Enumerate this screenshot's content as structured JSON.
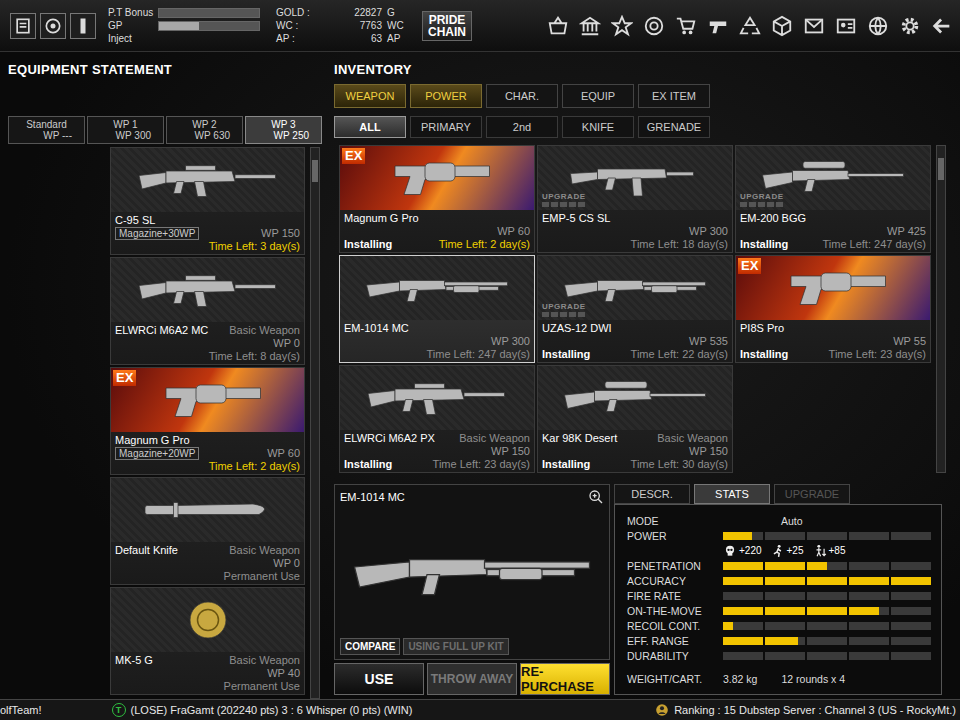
{
  "top_bar": {
    "pt_bonus": {
      "label": "P.T Bonus",
      "level": 0
    },
    "gp": {
      "label": "GP",
      "level": 0.4
    },
    "inject": "Inject",
    "currency": [
      {
        "label": "GOLD :",
        "value": "22827",
        "unit": "G"
      },
      {
        "label": "WC :",
        "value": "7763",
        "unit": "WC"
      },
      {
        "label": "AP :",
        "value": "63",
        "unit": "AP"
      }
    ],
    "logo": [
      "PRIDE",
      "CHAIN"
    ]
  },
  "equipment": {
    "title": "EQUIPMENT STATEMENT",
    "sets": [
      {
        "label": "Standard",
        "wp": "WP ---",
        "selected": false
      },
      {
        "label": "WP 1",
        "wp": "WP 300",
        "selected": false
      },
      {
        "label": "WP 2",
        "wp": "WP 630",
        "selected": false
      },
      {
        "label": "WP 3",
        "wp": "WP 250",
        "selected": true
      }
    ],
    "items": [
      {
        "name": "C-95 SL",
        "kind": "rifle",
        "tag": "Magazine+30WP",
        "wp": "WP 150",
        "time": "Time Left: 3 day(s)",
        "warn": true
      },
      {
        "name": "ELWRCi M6A2 MC",
        "kind": "rifle",
        "type": "Basic Weapon",
        "wp": "WP 0",
        "time": "Time Left: 8 day(s)",
        "warn": false
      },
      {
        "name": "Magnum G Pro",
        "kind": "pistol",
        "badge": {
          "text": "EX",
          "kind": "ex"
        },
        "tag": "Magazine+20WP",
        "wp": "WP 60",
        "time": "Time Left: 2 day(s)",
        "warn": true
      },
      {
        "name": "Default Knife",
        "kind": "knife",
        "type": "Basic Weapon",
        "wp": "WP 0",
        "time": "Permanent Use",
        "warn": false
      },
      {
        "name": "MK-5 G",
        "kind": "grenade",
        "type": "Basic Weapon",
        "wp": "WP 40",
        "time": "Permanent Use",
        "warn": false
      }
    ]
  },
  "inventory": {
    "title": "INVENTORY",
    "tabs": [
      {
        "label": "WEAPON",
        "selected": true,
        "hovered": false
      },
      {
        "label": "POWER",
        "selected": false,
        "hovered": true
      },
      {
        "label": "CHAR.",
        "selected": false,
        "hovered": false
      },
      {
        "label": "EQUIP",
        "selected": false,
        "hovered": false
      },
      {
        "label": "EX ITEM",
        "selected": false,
        "hovered": false
      }
    ],
    "subtabs": [
      {
        "label": "ALL",
        "selected": true
      },
      {
        "label": "PRIMARY",
        "selected": false
      },
      {
        "label": "2nd",
        "selected": false
      },
      {
        "label": "KNIFE",
        "selected": false
      },
      {
        "label": "GRENADE",
        "selected": false
      }
    ],
    "items": [
      {
        "name": "Magnum G Pro",
        "kind": "pistol",
        "badge": {
          "text": "EX",
          "kind": "ex"
        },
        "wp": "WP 60",
        "status": "Installing",
        "time": "Time Left: 2 day(s)",
        "warn": true,
        "selected": false
      },
      {
        "name": "EMP-5 CS SL",
        "kind": "smg",
        "badge": {
          "text": "UPGRADE",
          "kind": "upgrade"
        },
        "wp": "WP 300",
        "time": "Time Left: 18 day(s)",
        "warn": false,
        "selected": false
      },
      {
        "name": "EM-200 BGG",
        "kind": "sniper",
        "badge": {
          "text": "UPGRADE",
          "kind": "upgrade"
        },
        "wp": "WP 425",
        "status": "Installing",
        "time": "Time Left: 247 day(s)",
        "warn": false,
        "selected": false
      },
      {
        "name": "EM-1014 MC",
        "kind": "shotgun",
        "wp": "WP 300",
        "time": "Time Left: 247 day(s)",
        "warn": false,
        "selected": true
      },
      {
        "name": "UZAS-12 DWI",
        "kind": "shotgun",
        "badge": {
          "text": "UPGRADE",
          "kind": "upgrade"
        },
        "wp": "WP 535",
        "status": "Installing",
        "time": "Time Left: 22 day(s)",
        "warn": false,
        "selected": false
      },
      {
        "name": "PI8S Pro",
        "kind": "pistol",
        "badge": {
          "text": "EX",
          "kind": "ex"
        },
        "wp": "WP 55",
        "status": "Installing",
        "time": "Time Left: 23 day(s)",
        "warn": false,
        "selected": false
      },
      {
        "name": "ELWRCi M6A2 PX",
        "kind": "rifle",
        "type": "Basic Weapon",
        "wp": "WP 150",
        "status": "Installing",
        "time": "Time Left: 23 day(s)",
        "warn": false,
        "selected": false
      },
      {
        "name": "Kar 98K Desert",
        "kind": "sniper",
        "type": "Basic Weapon",
        "wp": "WP 150",
        "status": "Installing",
        "time": "Time Left: 30 day(s)",
        "warn": false,
        "selected": false
      }
    ]
  },
  "preview": {
    "name": "EM-1014 MC",
    "kind": "shotgun",
    "compare": "COMPARE",
    "full_up_kit": {
      "label": "USING FULL UP KIT",
      "disabled": true
    }
  },
  "actions": [
    {
      "label": "USE",
      "kind": "normal"
    },
    {
      "label": "THROW AWAY",
      "kind": "disabled"
    },
    {
      "label": "RE-PURCHASE",
      "kind": "highlight"
    }
  ],
  "stats": {
    "tabs": [
      {
        "label": "DESCR.",
        "selected": false,
        "disabled": false
      },
      {
        "label": "STATS",
        "selected": true,
        "disabled": false
      },
      {
        "label": "UPGRADE",
        "selected": false,
        "disabled": true
      }
    ],
    "mode": {
      "label": "MODE",
      "value": "Auto"
    },
    "power": {
      "label": "POWER",
      "level": 0.14
    },
    "modifiers": [
      {
        "kind": "head",
        "text": "+220"
      },
      {
        "kind": "body",
        "text": "+25"
      },
      {
        "kind": "leg",
        "text": "+85"
      }
    ],
    "bars": [
      {
        "label": "PENETRATION",
        "level": 0.5
      },
      {
        "label": "ACCURACY",
        "level": 1
      },
      {
        "label": "FIRE RATE",
        "level": 0
      },
      {
        "label": "ON-THE-MOVE",
        "level": 0.75
      },
      {
        "label": "RECOIL CONT.",
        "level": 0.05
      },
      {
        "label": "EFF. RANGE",
        "level": 0.36
      },
      {
        "label": "DURABILITY",
        "level": 0
      }
    ],
    "weight": {
      "label": "WEIGHT/CART.",
      "value": "3.82 kg",
      "rounds": "12 rounds x 4"
    }
  },
  "status_bar": {
    "left": "olfTeam!",
    "match_icon": "T",
    "match": "(LOSE) FraGamt (202240 pts) 3 : 6 Whisper (0 pts) (WIN)",
    "ranking": "Ranking : 15 Dubstep Server : Channel 3 (US - RockyMt.)"
  }
}
